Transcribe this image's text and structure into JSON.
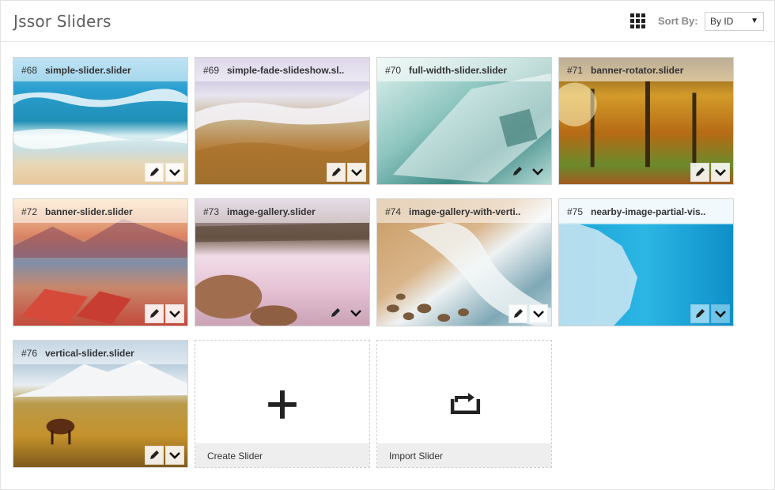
{
  "header": {
    "title": "Jssor Sliders",
    "grid_icon": "grid-view-icon",
    "sort_label": "Sort By:",
    "sort_value": "By ID",
    "sort_caret": "▼"
  },
  "sliders": [
    {
      "num": "#68",
      "name": "simple-slider.slider"
    },
    {
      "num": "#69",
      "name": "simple-fade-slideshow.sl.."
    },
    {
      "num": "#70",
      "name": "full-width-slider.slider"
    },
    {
      "num": "#71",
      "name": "banner-rotator.slider"
    },
    {
      "num": "#72",
      "name": "banner-slider.slider"
    },
    {
      "num": "#73",
      "name": "image-gallery.slider"
    },
    {
      "num": "#74",
      "name": "image-gallery-with-verti.."
    },
    {
      "num": "#75",
      "name": "nearby-image-partial-vis.."
    },
    {
      "num": "#76",
      "name": "vertical-slider.slider"
    }
  ],
  "actions": {
    "create_label": "Create Slider",
    "import_label": "Import Slider"
  },
  "icons": {
    "edit": "pencil-icon",
    "more": "chevron-down-icon",
    "create": "plus-icon",
    "import": "import-icon"
  }
}
